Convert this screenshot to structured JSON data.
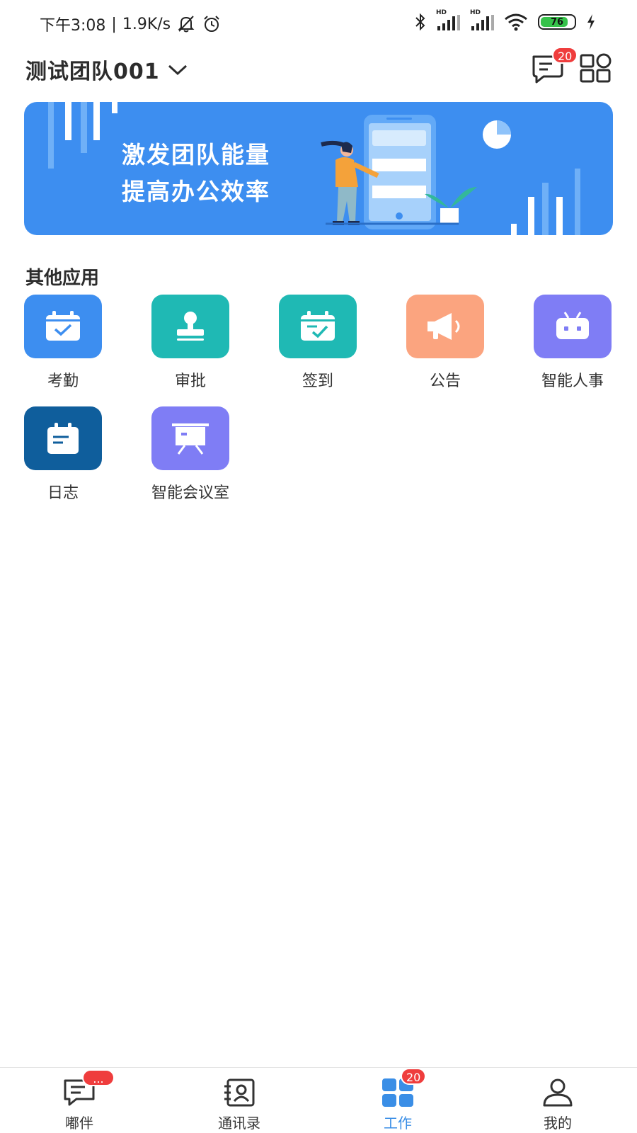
{
  "status_bar": {
    "time": "下午3:08",
    "net_speed": "1.9K/s",
    "signal_1_label": "HD",
    "signal_2_label": "HD",
    "battery_level": "76",
    "icons": [
      "mute-bell-icon",
      "alarm-icon",
      "bluetooth-icon",
      "signal-icon",
      "signal-icon",
      "wifi-icon",
      "battery-icon",
      "charging-icon"
    ]
  },
  "header": {
    "team_name": "测试团队001",
    "message_badge": "20",
    "icons": [
      "chevron-down-icon",
      "message-icon",
      "apps-grid-icon"
    ]
  },
  "banner": {
    "line1": "激发团队能量",
    "line2": "提高办公效率"
  },
  "section": {
    "title": "其他应用"
  },
  "apps": [
    {
      "label": "考勤",
      "color": "#3d8ef0",
      "icon": "calendar-check-icon"
    },
    {
      "label": "审批",
      "color": "#1fb9b4",
      "icon": "stamp-icon"
    },
    {
      "label": "签到",
      "color": "#1fb9b4",
      "icon": "calendar-sign-icon"
    },
    {
      "label": "公告",
      "color": "#fba47f",
      "icon": "megaphone-icon"
    },
    {
      "label": "智能人事",
      "color": "#7f7df5",
      "icon": "robot-icon"
    },
    {
      "label": "日志",
      "color": "#0f5e9c",
      "icon": "journal-icon"
    },
    {
      "label": "智能会议室",
      "color": "#7f7df5",
      "icon": "presentation-board-icon"
    }
  ],
  "tabbar": {
    "tabs": [
      {
        "label": "嘟伴",
        "badge": "...",
        "icon": "chat-icon",
        "active": false
      },
      {
        "label": "通讯录",
        "badge": "",
        "icon": "contacts-book-icon",
        "active": false
      },
      {
        "label": "工作",
        "badge": "20",
        "icon": "work-grid-icon",
        "active": true
      },
      {
        "label": "我的",
        "badge": "",
        "icon": "person-icon",
        "active": false
      }
    ],
    "active_color": "#3a8ee6"
  }
}
